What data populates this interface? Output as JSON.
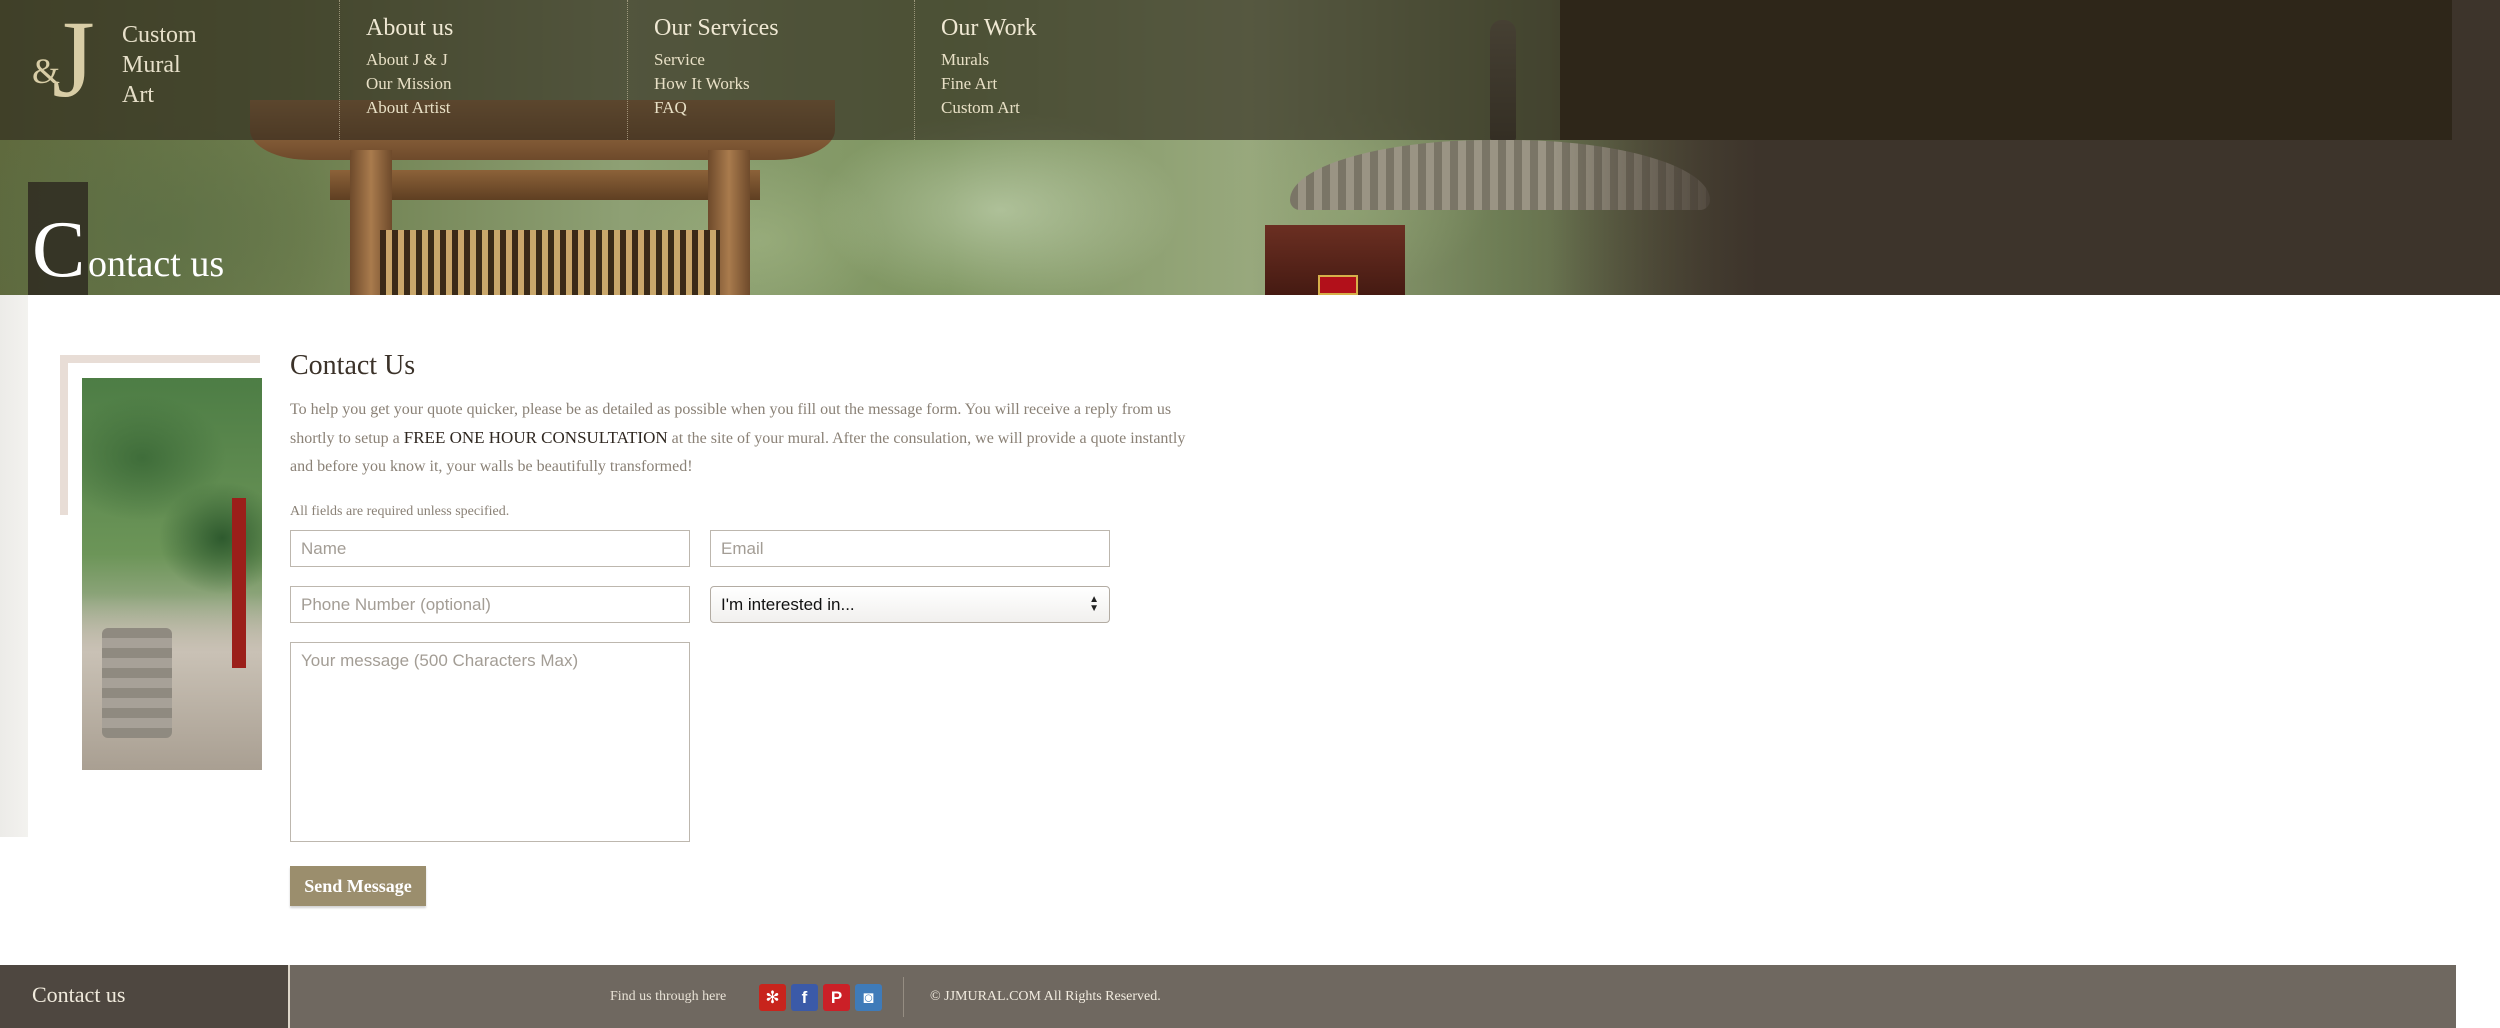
{
  "logo": {
    "amp": "&",
    "j": "J",
    "lines": [
      "Custom",
      "Mural",
      "Art"
    ]
  },
  "nav": [
    {
      "heading": "About us",
      "links": [
        "About J & J",
        "Our Mission",
        "About Artist"
      ]
    },
    {
      "heading": "Our Services",
      "links": [
        "Service",
        "How It Works",
        "FAQ"
      ]
    },
    {
      "heading": "Our Work",
      "links": [
        "Murals",
        "Fine Art",
        "Custom Art"
      ]
    }
  ],
  "page_title": {
    "cap": "C",
    "rest": "ontact us"
  },
  "content": {
    "heading": "Contact Us",
    "intro_a": "To help you get your quote quicker, please be as detailed as possible when you fill out the message form. You will receive a reply from us shortly to setup a ",
    "intro_strong": "FREE ONE HOUR CONSULTATION",
    "intro_b": " at the site of your mural. After the consulation, we will provide a quote instantly and before you know it, your walls be beautifully transformed!",
    "required_note": "All fields are required unless specified."
  },
  "form": {
    "name_placeholder": "Name",
    "email_placeholder": "Email",
    "phone_placeholder": "Phone Number (optional)",
    "interest_selected": "I'm interested in...",
    "message_placeholder": "Your message (500 Characters Max)",
    "send_label": "Send Message"
  },
  "footer": {
    "contact_label": "Contact us",
    "find_us": "Find us through here",
    "social": [
      {
        "name": "yelp-icon",
        "glyph": "✻",
        "color": "#c8241c"
      },
      {
        "name": "facebook-icon",
        "glyph": "f",
        "color": "#3b5aa8"
      },
      {
        "name": "pinterest-icon",
        "glyph": "P",
        "color": "#cb2027"
      },
      {
        "name": "instagram-icon",
        "glyph": "◙",
        "color": "#3f7bb9"
      }
    ],
    "copyright": "© JJMURAL.COM All Rights Reserved."
  },
  "colors": {
    "button": "#9b8e6d",
    "footer": "#6f6860",
    "footer_left": "#4e4740",
    "nav_dark": "#2e2619"
  }
}
